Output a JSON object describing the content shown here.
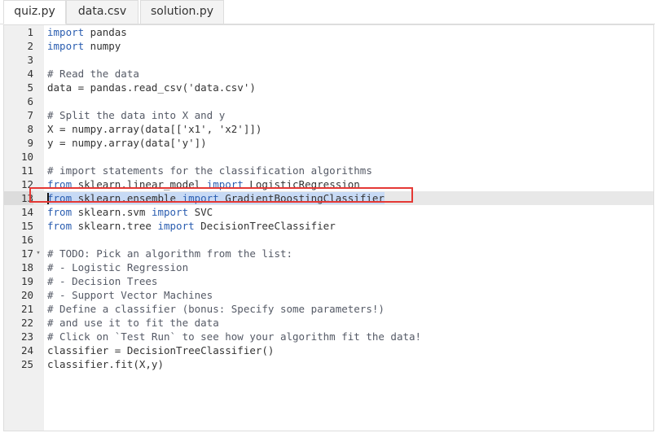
{
  "tabs": [
    {
      "label": "quiz.py",
      "active": true
    },
    {
      "label": "data.csv",
      "active": false
    },
    {
      "label": "solution.py",
      "active": false
    }
  ],
  "editor": {
    "current_line": 13,
    "highlight_color": "#e53935",
    "lines": [
      {
        "num": "1",
        "parts": [
          {
            "t": "kw",
            "s": "import"
          },
          {
            "t": "tx",
            "s": " pandas"
          }
        ]
      },
      {
        "num": "2",
        "parts": [
          {
            "t": "kw",
            "s": "import"
          },
          {
            "t": "tx",
            "s": " numpy"
          }
        ]
      },
      {
        "num": "3",
        "parts": []
      },
      {
        "num": "4",
        "parts": [
          {
            "t": "cm",
            "s": "# Read the data"
          }
        ]
      },
      {
        "num": "5",
        "parts": [
          {
            "t": "tx",
            "s": "data = pandas.read_csv('data.csv')"
          }
        ]
      },
      {
        "num": "6",
        "parts": []
      },
      {
        "num": "7",
        "parts": [
          {
            "t": "cm",
            "s": "# Split the data into X and y"
          }
        ]
      },
      {
        "num": "8",
        "parts": [
          {
            "t": "tx",
            "s": "X = numpy.array(data[['x1', 'x2']])"
          }
        ]
      },
      {
        "num": "9",
        "parts": [
          {
            "t": "tx",
            "s": "y = numpy.array(data['y'])"
          }
        ]
      },
      {
        "num": "10",
        "parts": []
      },
      {
        "num": "11",
        "parts": [
          {
            "t": "cm",
            "s": "# import statements for the classification algorithms"
          }
        ]
      },
      {
        "num": "12",
        "parts": [
          {
            "t": "kw",
            "s": "from"
          },
          {
            "t": "tx",
            "s": " sklearn.linear_model "
          },
          {
            "t": "kw",
            "s": "import"
          },
          {
            "t": "tx",
            "s": " LogisticRegression"
          }
        ]
      },
      {
        "num": "13",
        "parts": [
          {
            "t": "cursor",
            "s": ""
          },
          {
            "t": "selkw",
            "s": "from"
          },
          {
            "t": "sel",
            "s": " sklearn.ensemble "
          },
          {
            "t": "selkw",
            "s": "import"
          },
          {
            "t": "sel",
            "s": " GradientBoostingClassifier"
          }
        ]
      },
      {
        "num": "14",
        "parts": [
          {
            "t": "kw",
            "s": "from"
          },
          {
            "t": "tx",
            "s": " sklearn.svm "
          },
          {
            "t": "kw",
            "s": "import"
          },
          {
            "t": "tx",
            "s": " SVC"
          }
        ]
      },
      {
        "num": "15",
        "parts": [
          {
            "t": "kw",
            "s": "from"
          },
          {
            "t": "tx",
            "s": " sklearn.tree "
          },
          {
            "t": "kw",
            "s": "import"
          },
          {
            "t": "tx",
            "s": " DecisionTreeClassifier"
          }
        ]
      },
      {
        "num": "16",
        "parts": []
      },
      {
        "num": "17",
        "fold": true,
        "parts": [
          {
            "t": "cm",
            "s": "# TODO: Pick an algorithm from the list:"
          }
        ]
      },
      {
        "num": "18",
        "parts": [
          {
            "t": "cm",
            "s": "# - Logistic Regression"
          }
        ]
      },
      {
        "num": "19",
        "parts": [
          {
            "t": "cm",
            "s": "# - Decision Trees"
          }
        ]
      },
      {
        "num": "20",
        "parts": [
          {
            "t": "cm",
            "s": "# - Support Vector Machines"
          }
        ]
      },
      {
        "num": "21",
        "parts": [
          {
            "t": "cm",
            "s": "# Define a classifier (bonus: Specify some parameters!)"
          }
        ]
      },
      {
        "num": "22",
        "parts": [
          {
            "t": "cm",
            "s": "# and use it to fit the data"
          }
        ]
      },
      {
        "num": "23",
        "parts": [
          {
            "t": "cm",
            "s": "# Click on `Test Run` to see how your algorithm fit the data!"
          }
        ]
      },
      {
        "num": "24",
        "parts": [
          {
            "t": "tx",
            "s": "classifier = DecisionTreeClassifier()"
          }
        ]
      },
      {
        "num": "25",
        "parts": [
          {
            "t": "tx",
            "s": "classifier.fit(X,y)"
          }
        ]
      }
    ]
  }
}
